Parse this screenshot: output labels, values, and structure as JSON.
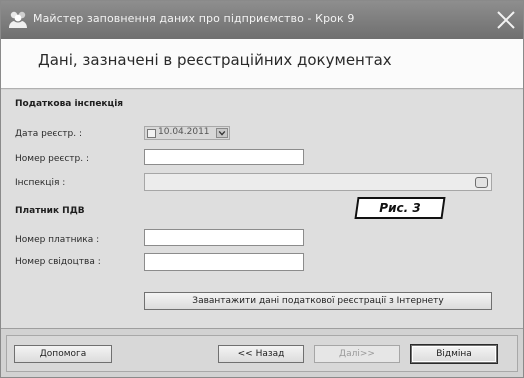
{
  "window": {
    "title": "Майстер заповнення даних про підприємство - Крок 9",
    "app_icon": "group-users-icon",
    "close_icon": "close-icon"
  },
  "header": {
    "title": "Дані, зазначені в реєстраційних документах"
  },
  "figure_label": "Рис. 3",
  "tax_inspection": {
    "section_title": "Податкова інспекція",
    "reg_date_label": "Дата реєстр. :",
    "reg_date_value": "10.04.2011",
    "reg_date_checked": false,
    "reg_number_label": "Номер реєстр. :",
    "reg_number_value": "",
    "inspection_label": "Інспекція :",
    "inspection_value": ""
  },
  "vat_payer": {
    "section_title": "Платник ПДВ",
    "payer_number_label": "Номер платника :",
    "payer_number_value": "",
    "certificate_number_label": "Номер свідоцтва :",
    "certificate_number_value": ""
  },
  "load_button_label": "Завантажити дані податкової реєстрації з Інтернету",
  "footer": {
    "help_label": "Допомога",
    "back_label": "<< Назад",
    "next_label": "Далі>>",
    "cancel_label": "Відміна"
  }
}
